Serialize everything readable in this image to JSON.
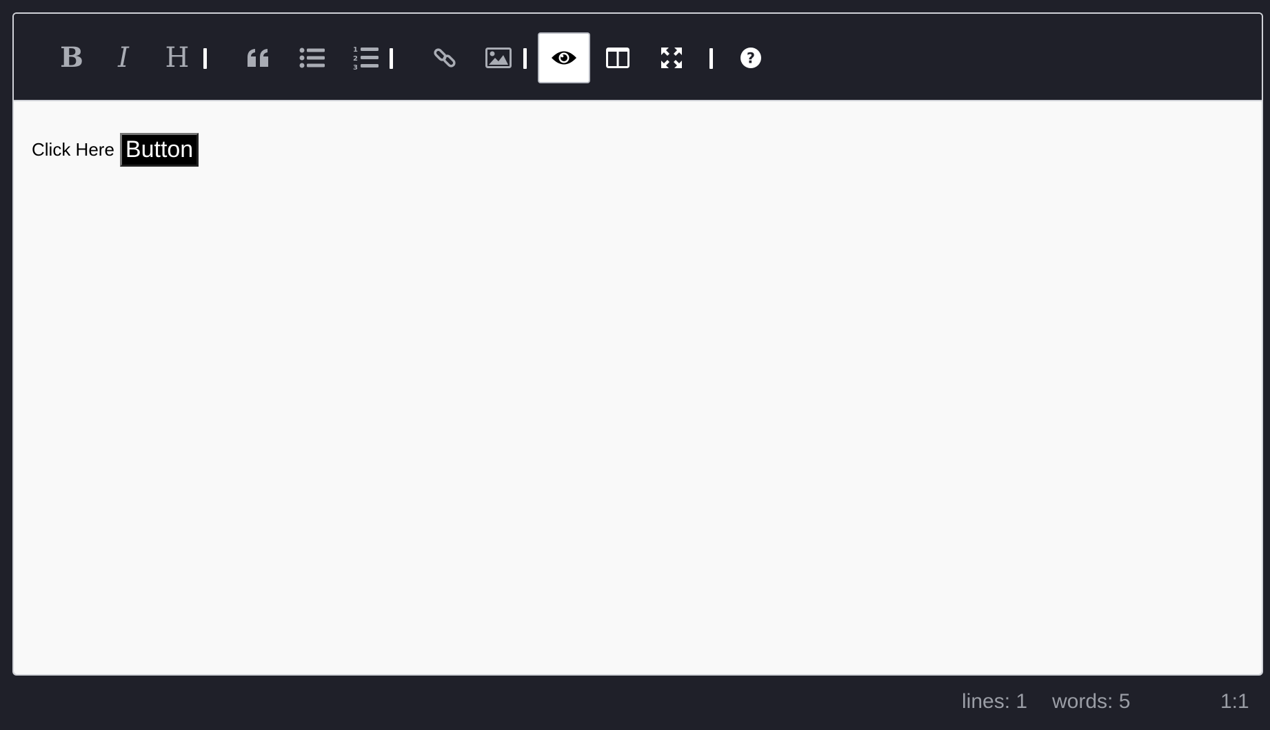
{
  "toolbar": {
    "bold_letter": "B",
    "italic_letter": "I",
    "heading_letter": "H"
  },
  "icons": {
    "bold": "bold-icon",
    "italic": "italic-icon",
    "heading": "heading-icon",
    "quote": "quote-icon",
    "unordered_list": "unordered-list-icon",
    "ordered_list": "ordered-list-icon",
    "link": "link-icon",
    "image": "image-icon",
    "preview": "eye-icon",
    "side_by_side": "columns-icon",
    "fullscreen": "fullscreen-icon",
    "guide": "question-circle-icon"
  },
  "preview": {
    "text": "Click Here",
    "button_label": "Button"
  },
  "status": {
    "lines": "lines: 1",
    "words": "words: 5",
    "cursor": "1:1"
  },
  "colors": {
    "background": "#1f2029",
    "toolbar_icon": "#a9acb4",
    "active_button_bg": "#ffffff",
    "preview_bg": "#f9f9f9",
    "status_text": "#9a9da5"
  }
}
